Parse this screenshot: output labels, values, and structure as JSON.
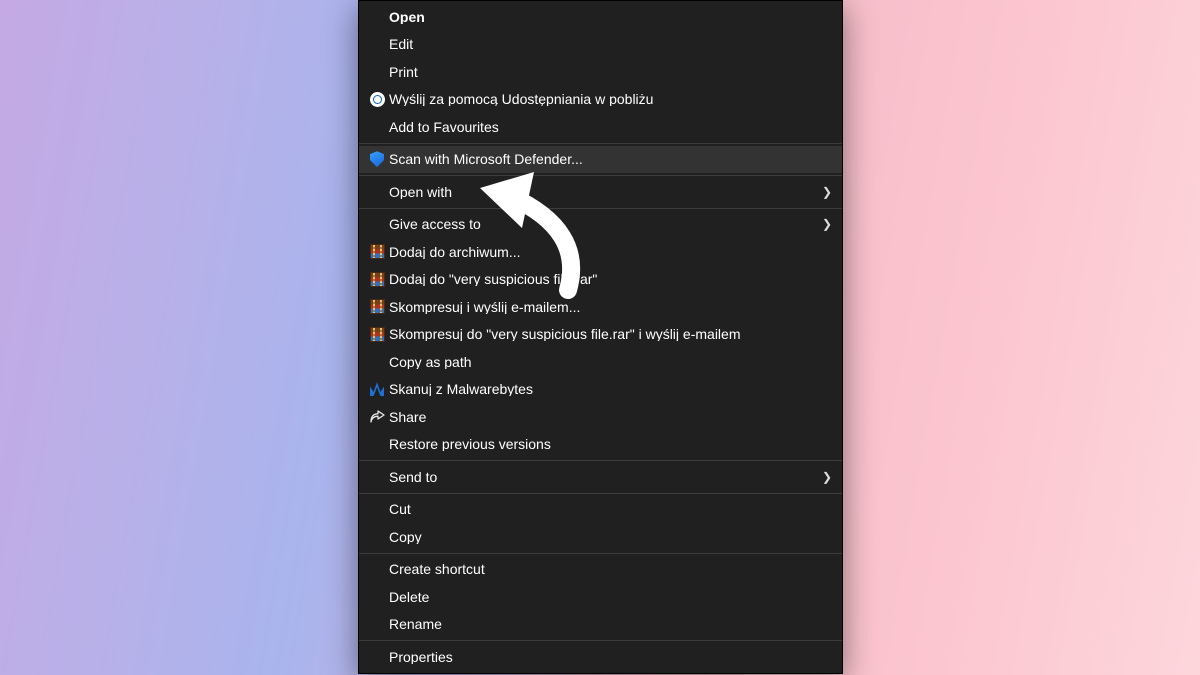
{
  "menu": {
    "groups": [
      [
        {
          "name": "menu-open",
          "label": "Open",
          "icon": null,
          "submenu": false,
          "bold": true,
          "highlight": false
        },
        {
          "name": "menu-edit",
          "label": "Edit",
          "icon": null,
          "submenu": false,
          "bold": false,
          "highlight": false
        },
        {
          "name": "menu-print",
          "label": "Print",
          "icon": null,
          "submenu": false,
          "bold": false,
          "highlight": false
        },
        {
          "name": "menu-nearby-share",
          "label": "Wyślij za pomocą Udostępniania w pobliżu",
          "icon": "nearby-share-icon",
          "submenu": false,
          "bold": false,
          "highlight": false
        },
        {
          "name": "menu-favourites",
          "label": "Add to Favourites",
          "icon": null,
          "submenu": false,
          "bold": false,
          "highlight": false
        }
      ],
      [
        {
          "name": "menu-defender-scan",
          "label": "Scan with Microsoft Defender...",
          "icon": "defender-shield-icon",
          "submenu": false,
          "bold": false,
          "highlight": true
        }
      ],
      [
        {
          "name": "menu-open-with",
          "label": "Open with",
          "icon": null,
          "submenu": true,
          "bold": false,
          "highlight": false
        }
      ],
      [
        {
          "name": "menu-give-access",
          "label": "Give access to",
          "icon": null,
          "submenu": true,
          "bold": false,
          "highlight": false
        },
        {
          "name": "menu-rar-add",
          "label": "Dodaj do archiwum...",
          "icon": "winrar-icon",
          "submenu": false,
          "bold": false,
          "highlight": false
        },
        {
          "name": "menu-rar-addname",
          "label": "Dodaj do \"very suspicious file.rar\"",
          "icon": "winrar-icon",
          "submenu": false,
          "bold": false,
          "highlight": false
        },
        {
          "name": "menu-rar-email",
          "label": "Skompresuj i wyślij e-mailem...",
          "icon": "winrar-icon",
          "submenu": false,
          "bold": false,
          "highlight": false
        },
        {
          "name": "menu-rar-nameemail",
          "label": "Skompresuj do \"very suspicious file.rar\" i wyślij e-mailem",
          "icon": "winrar-icon",
          "submenu": false,
          "bold": false,
          "highlight": false
        },
        {
          "name": "menu-copy-path",
          "label": "Copy as path",
          "icon": null,
          "submenu": false,
          "bold": false,
          "highlight": false
        },
        {
          "name": "menu-mwb-scan",
          "label": "Skanuj z Malwarebytes",
          "icon": "malwarebytes-icon",
          "submenu": false,
          "bold": false,
          "highlight": false
        },
        {
          "name": "menu-share",
          "label": "Share",
          "icon": "share-icon",
          "submenu": false,
          "bold": false,
          "highlight": false
        },
        {
          "name": "menu-restore",
          "label": "Restore previous versions",
          "icon": null,
          "submenu": false,
          "bold": false,
          "highlight": false
        }
      ],
      [
        {
          "name": "menu-send-to",
          "label": "Send to",
          "icon": null,
          "submenu": true,
          "bold": false,
          "highlight": false
        }
      ],
      [
        {
          "name": "menu-cut",
          "label": "Cut",
          "icon": null,
          "submenu": false,
          "bold": false,
          "highlight": false
        },
        {
          "name": "menu-copy",
          "label": "Copy",
          "icon": null,
          "submenu": false,
          "bold": false,
          "highlight": false
        }
      ],
      [
        {
          "name": "menu-shortcut",
          "label": "Create shortcut",
          "icon": null,
          "submenu": false,
          "bold": false,
          "highlight": false
        },
        {
          "name": "menu-delete",
          "label": "Delete",
          "icon": null,
          "submenu": false,
          "bold": false,
          "highlight": false
        },
        {
          "name": "menu-rename",
          "label": "Rename",
          "icon": null,
          "submenu": false,
          "bold": false,
          "highlight": false
        }
      ],
      [
        {
          "name": "menu-properties",
          "label": "Properties",
          "icon": null,
          "submenu": false,
          "bold": false,
          "highlight": false
        }
      ]
    ]
  }
}
